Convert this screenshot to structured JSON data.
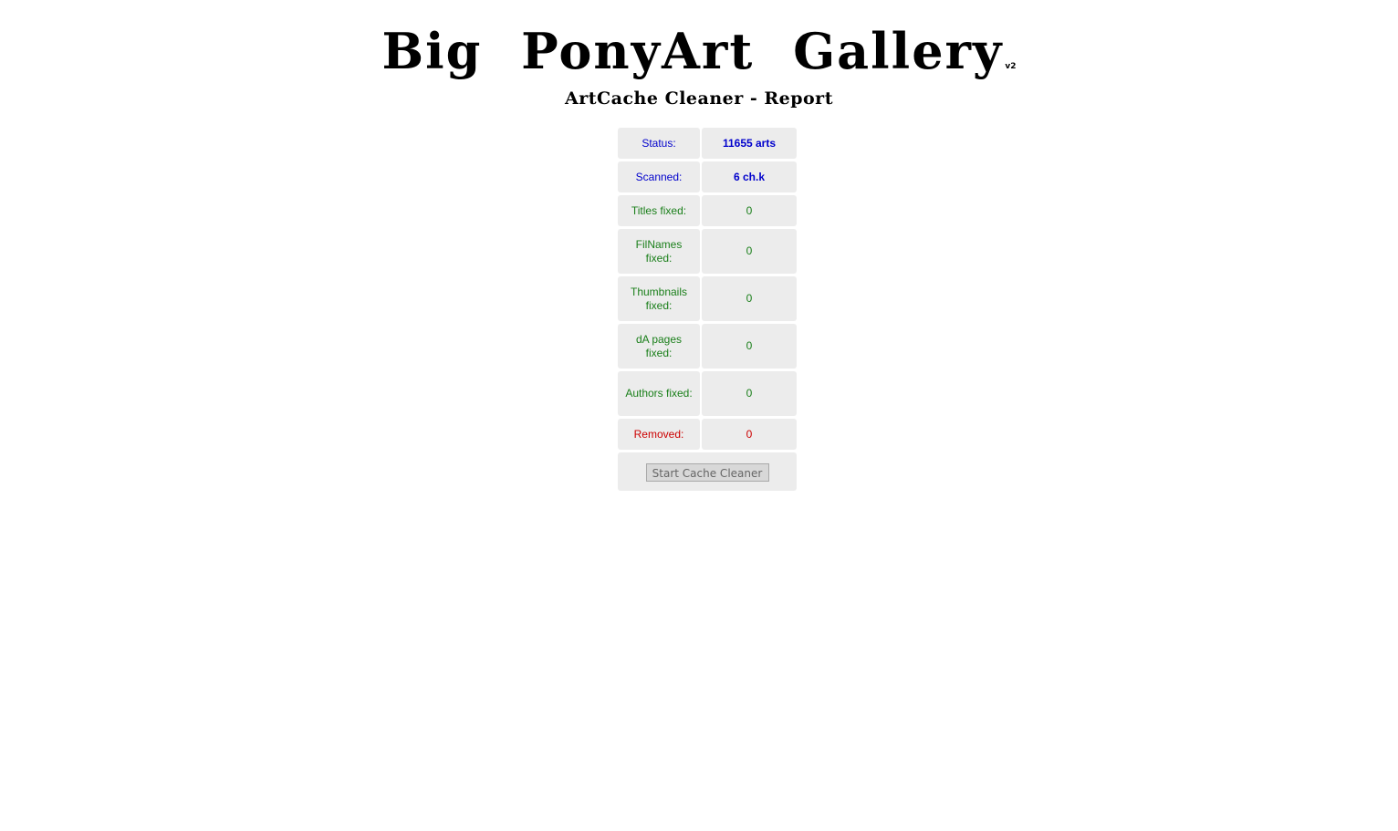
{
  "header": {
    "title": "Big PonyArt Gallery",
    "version": "v2",
    "subtitle": "ArtCache Cleaner - Report"
  },
  "report": {
    "rows": [
      {
        "label": "Status:",
        "value": "11655 arts"
      },
      {
        "label": "Scanned:",
        "value": "6 ch.k"
      },
      {
        "label": "Titles fixed:",
        "value": "0"
      },
      {
        "label": "FilNames fixed:",
        "value": "0"
      },
      {
        "label": "Thumbnails fixed:",
        "value": "0"
      },
      {
        "label": "dA pages fixed:",
        "value": "0"
      },
      {
        "label": "Authors fixed:",
        "value": "0"
      },
      {
        "label": "Removed:",
        "value": "0"
      }
    ],
    "button_label": "Start Cache Cleaner"
  },
  "colors": {
    "status": "#0000cc",
    "fixed": "#1a7f1a",
    "removed": "#cc0000",
    "cell_background": "#ececec"
  }
}
